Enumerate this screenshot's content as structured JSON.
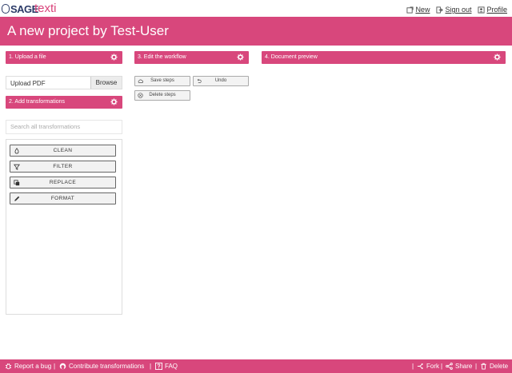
{
  "brand": {
    "sage": "SAGE",
    "app": "texti"
  },
  "topnav": {
    "new": "New",
    "signout": "Sign out",
    "profile": "Profile"
  },
  "banner": {
    "title": "A new project by Test-User"
  },
  "panels": {
    "upload": {
      "title": "1. Upload a file",
      "placeholder": "Upload PDF",
      "browse": "Browse"
    },
    "transform": {
      "title": "2. Add transformations",
      "search_placeholder": "Search all transformations",
      "buttons": [
        "CLEAN",
        "FILTER",
        "REPLACE",
        "FORMAT"
      ]
    },
    "workflow": {
      "title": "3. Edit the workflow",
      "save": "Save steps",
      "undo": "Undo",
      "delete": "Delete steps"
    },
    "preview": {
      "title": "4. Document preview"
    }
  },
  "footer": {
    "report": "Report a bug",
    "contribute": "Contribute transformations",
    "faq": "FAQ",
    "fork": "Fork",
    "share": "Share",
    "delete": "Delete",
    "separator": "|"
  },
  "colors": {
    "accent": "#d8477c",
    "brand_text": "#d9437a",
    "sage_navy": "#2b3a67"
  }
}
